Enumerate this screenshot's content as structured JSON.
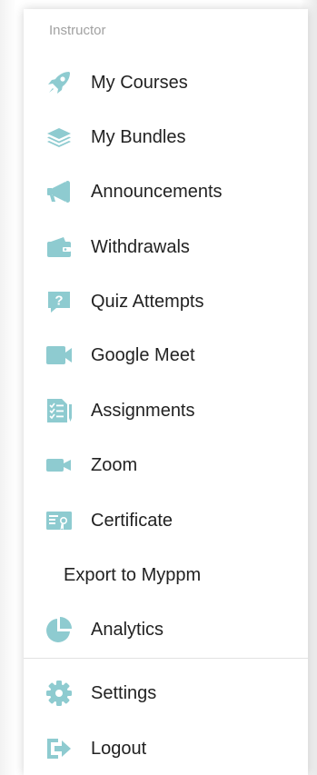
{
  "section_label": "Instructor",
  "accent_color": "#8ecbd0",
  "menu": {
    "my_courses": "My Courses",
    "my_bundles": "My Bundles",
    "announcements": "Announcements",
    "withdrawals": "Withdrawals",
    "quiz_attempts": "Quiz Attempts",
    "google_meet": "Google Meet",
    "assignments": "Assignments",
    "zoom": "Zoom",
    "certificate": "Certificate",
    "export": "Export to Myppm",
    "analytics": "Analytics",
    "settings": "Settings",
    "logout": "Logout"
  },
  "icons": {
    "my_courses": "rocket-icon",
    "my_bundles": "layers-icon",
    "announcements": "megaphone-icon",
    "withdrawals": "wallet-icon",
    "quiz_attempts": "question-icon",
    "google_meet": "video-camera-icon",
    "assignments": "checklist-icon",
    "zoom": "video-icon",
    "certificate": "certificate-icon",
    "analytics": "pie-chart-icon",
    "settings": "gear-icon",
    "logout": "logout-icon"
  }
}
